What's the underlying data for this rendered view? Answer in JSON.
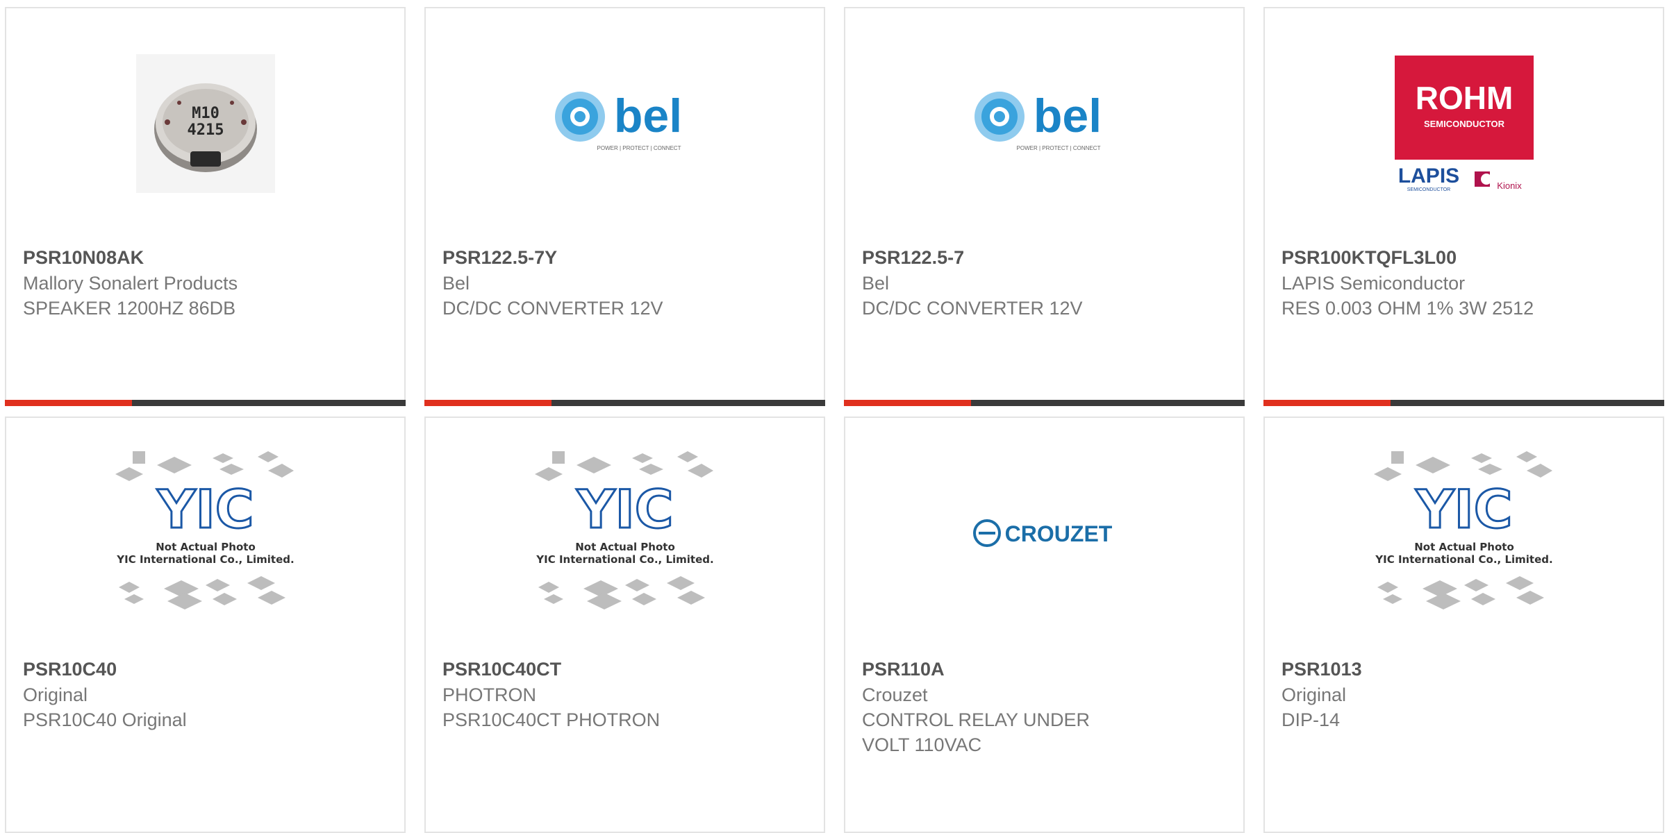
{
  "colors": {
    "accent": "#e0301e",
    "bar": "#3a3a3a",
    "bel_blue": "#1a84c7",
    "rohm_red": "#d6183c",
    "crouzet_blue": "#1b6ea8"
  },
  "products": [
    {
      "part": "PSR10N08AK",
      "brand": "Mallory Sonalert Products",
      "desc": [
        "SPEAKER 1200HZ 86DB"
      ],
      "image": "speaker-photo",
      "image_text": [
        "M10",
        "4215"
      ]
    },
    {
      "part": "PSR122.5-7Y",
      "brand": "Bel",
      "desc": [
        "DC/DC CONVERTER 12V"
      ],
      "image": "bel-logo",
      "image_text": [
        "bel",
        "POWER | PROTECT | CONNECT"
      ]
    },
    {
      "part": "PSR122.5-7",
      "brand": "Bel",
      "desc": [
        "DC/DC CONVERTER 12V"
      ],
      "image": "bel-logo",
      "image_text": [
        "bel",
        "POWER | PROTECT | CONNECT"
      ]
    },
    {
      "part": "PSR100KTQFL3L00",
      "brand": "LAPIS Semiconductor",
      "desc": [
        "RES 0.003 OHM 1% 3W 2512"
      ],
      "image": "rohm-logo",
      "image_text": [
        "ROHM",
        "SEMICONDUCTOR",
        "LAPIS",
        "SEMICONDUCTOR",
        "Kionix"
      ]
    },
    {
      "part": "PSR10C40",
      "brand": "Original",
      "desc": [
        "PSR10C40 Original"
      ],
      "image": "yic-placeholder",
      "image_text": [
        "YIC",
        "Not Actual Photo",
        "YIC International Co., Limited."
      ]
    },
    {
      "part": "PSR10C40CT",
      "brand": "PHOTRON",
      "desc": [
        "PSR10C40CT PHOTRON"
      ],
      "image": "yic-placeholder",
      "image_text": [
        "YIC",
        "Not Actual Photo",
        "YIC International Co., Limited."
      ]
    },
    {
      "part": "PSR110A",
      "brand": "Crouzet",
      "desc": [
        "CONTROL RELAY UNDER",
        "VOLT 110VAC"
      ],
      "image": "crouzet-logo",
      "image_text": [
        "CROUZET"
      ]
    },
    {
      "part": "PSR1013",
      "brand": "Original",
      "desc": [
        "DIP-14"
      ],
      "image": "yic-placeholder",
      "image_text": [
        "YIC",
        "Not Actual Photo",
        "YIC International Co., Limited."
      ]
    }
  ]
}
